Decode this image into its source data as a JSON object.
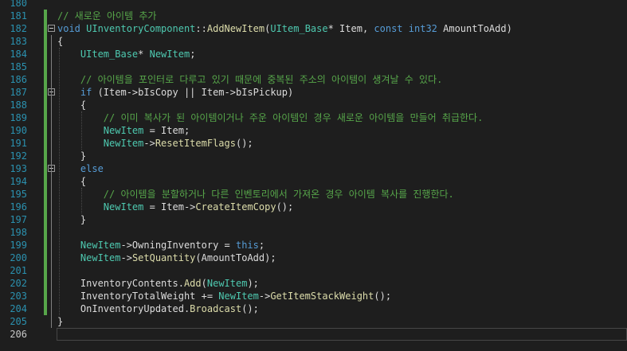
{
  "editor": {
    "lines": [
      {
        "num": "180",
        "segments": []
      },
      {
        "num": "181",
        "segments": [
          {
            "cls": "cm",
            "text": "// 새로운 아이템 추가"
          }
        ]
      },
      {
        "num": "182",
        "fold": "-",
        "segments": [
          {
            "cls": "kw",
            "text": "void"
          },
          {
            "cls": "tx",
            "text": " "
          },
          {
            "cls": "ty",
            "text": "UInventoryComponent"
          },
          {
            "cls": "tx",
            "text": "::"
          },
          {
            "cls": "fn",
            "text": "AddNewItem"
          },
          {
            "cls": "tx",
            "text": "("
          },
          {
            "cls": "ty",
            "text": "UItem_Base"
          },
          {
            "cls": "tx",
            "text": "* Item, "
          },
          {
            "cls": "kw",
            "text": "const"
          },
          {
            "cls": "tx",
            "text": " "
          },
          {
            "cls": "kw",
            "text": "int32"
          },
          {
            "cls": "tx",
            "text": " AmountToAdd)"
          }
        ]
      },
      {
        "num": "183",
        "segments": [
          {
            "cls": "tx",
            "text": "{"
          }
        ]
      },
      {
        "num": "184",
        "segments": [
          {
            "cls": "tx",
            "text": "    "
          },
          {
            "cls": "ty",
            "text": "UItem_Base"
          },
          {
            "cls": "tx",
            "text": "* "
          },
          {
            "cls": "ty",
            "text": "NewItem"
          },
          {
            "cls": "tx",
            "text": ";"
          }
        ]
      },
      {
        "num": "185",
        "segments": []
      },
      {
        "num": "186",
        "segments": [
          {
            "cls": "tx",
            "text": "    "
          },
          {
            "cls": "cm",
            "text": "// 아이템을 포인터로 다루고 있기 때문에 중복된 주소의 아이템이 생겨날 수 있다."
          }
        ]
      },
      {
        "num": "187",
        "fold": "-",
        "segments": [
          {
            "cls": "tx",
            "text": "    "
          },
          {
            "cls": "kw",
            "text": "if"
          },
          {
            "cls": "tx",
            "text": " (Item->bIsCopy || Item->bIsPickup)"
          }
        ]
      },
      {
        "num": "188",
        "segments": [
          {
            "cls": "tx",
            "text": "    {"
          }
        ]
      },
      {
        "num": "189",
        "segments": [
          {
            "cls": "tx",
            "text": "        "
          },
          {
            "cls": "cm",
            "text": "// 이미 복사가 된 아이템이거나 주운 아이템인 경우 새로운 아이템을 만들어 취급한다."
          }
        ]
      },
      {
        "num": "190",
        "segments": [
          {
            "cls": "tx",
            "text": "        "
          },
          {
            "cls": "ty",
            "text": "NewItem"
          },
          {
            "cls": "tx",
            "text": " = Item;"
          }
        ]
      },
      {
        "num": "191",
        "segments": [
          {
            "cls": "tx",
            "text": "        "
          },
          {
            "cls": "ty",
            "text": "NewItem"
          },
          {
            "cls": "tx",
            "text": "->"
          },
          {
            "cls": "fn",
            "text": "ResetItemFlags"
          },
          {
            "cls": "tx",
            "text": "();"
          }
        ]
      },
      {
        "num": "192",
        "segments": [
          {
            "cls": "tx",
            "text": "    }"
          }
        ]
      },
      {
        "num": "193",
        "fold": "-",
        "segments": [
          {
            "cls": "tx",
            "text": "    "
          },
          {
            "cls": "kw",
            "text": "else"
          }
        ]
      },
      {
        "num": "194",
        "segments": [
          {
            "cls": "tx",
            "text": "    {"
          }
        ]
      },
      {
        "num": "195",
        "segments": [
          {
            "cls": "tx",
            "text": "        "
          },
          {
            "cls": "cm",
            "text": "// 아이템을 분할하거나 다른 인벤토리에서 가져온 경우 아이템 복사를 진행한다."
          }
        ]
      },
      {
        "num": "196",
        "segments": [
          {
            "cls": "tx",
            "text": "        "
          },
          {
            "cls": "ty",
            "text": "NewItem"
          },
          {
            "cls": "tx",
            "text": " = Item->"
          },
          {
            "cls": "fn",
            "text": "CreateItemCopy"
          },
          {
            "cls": "tx",
            "text": "();"
          }
        ]
      },
      {
        "num": "197",
        "segments": [
          {
            "cls": "tx",
            "text": "    }"
          }
        ]
      },
      {
        "num": "198",
        "segments": []
      },
      {
        "num": "199",
        "segments": [
          {
            "cls": "tx",
            "text": "    "
          },
          {
            "cls": "ty",
            "text": "NewItem"
          },
          {
            "cls": "tx",
            "text": "->OwningInventory = "
          },
          {
            "cls": "kw",
            "text": "this"
          },
          {
            "cls": "tx",
            "text": ";"
          }
        ]
      },
      {
        "num": "200",
        "segments": [
          {
            "cls": "tx",
            "text": "    "
          },
          {
            "cls": "ty",
            "text": "NewItem"
          },
          {
            "cls": "tx",
            "text": "->"
          },
          {
            "cls": "fn",
            "text": "SetQuantity"
          },
          {
            "cls": "tx",
            "text": "(AmountToAdd);"
          }
        ]
      },
      {
        "num": "201",
        "segments": []
      },
      {
        "num": "202",
        "segments": [
          {
            "cls": "tx",
            "text": "    InventoryContents."
          },
          {
            "cls": "fn",
            "text": "Add"
          },
          {
            "cls": "tx",
            "text": "("
          },
          {
            "cls": "ty",
            "text": "NewItem"
          },
          {
            "cls": "tx",
            "text": ");"
          }
        ]
      },
      {
        "num": "203",
        "segments": [
          {
            "cls": "tx",
            "text": "    InventoryTotalWeight += "
          },
          {
            "cls": "ty",
            "text": "NewItem"
          },
          {
            "cls": "tx",
            "text": "->"
          },
          {
            "cls": "fn",
            "text": "GetItemStackWeight"
          },
          {
            "cls": "tx",
            "text": "();"
          }
        ]
      },
      {
        "num": "204",
        "segments": [
          {
            "cls": "tx",
            "text": "    OnInventoryUpdated."
          },
          {
            "cls": "fn",
            "text": "Broadcast"
          },
          {
            "cls": "tx",
            "text": "();"
          }
        ]
      },
      {
        "num": "205",
        "segments": [
          {
            "cls": "tx",
            "text": "}"
          }
        ]
      },
      {
        "num": "206",
        "current": true,
        "segments": []
      }
    ]
  }
}
